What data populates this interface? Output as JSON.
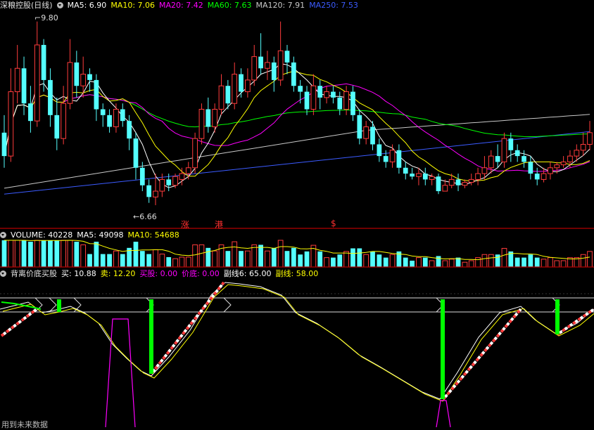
{
  "header_main": {
    "title": "深粮控股(日线)",
    "ma": [
      {
        "label": "MA5: 6.90",
        "color": "#ffffff"
      },
      {
        "label": "MA10: 7.06",
        "color": "#ffff00"
      },
      {
        "label": "MA20: 7.42",
        "color": "#ff00ff"
      },
      {
        "label": "MA60: 7.63",
        "color": "#00ff00"
      },
      {
        "label": "MA120: 7.91",
        "color": "#c8c8c8"
      },
      {
        "label": "MA250: 7.53",
        "color": "#3b5bff"
      }
    ]
  },
  "price_labels": {
    "high": "9.80",
    "low": "6.66"
  },
  "markers": [
    {
      "text": "涨",
      "color": "#ff3030"
    },
    {
      "text": "港",
      "color": "#ff3030"
    },
    {
      "text": "$",
      "color": "#ff3030"
    }
  ],
  "header_volume": {
    "items": [
      {
        "label": "VOLUME: 40228",
        "color": "#ffffff"
      },
      {
        "label": "MA5: 49098",
        "color": "#ffffff"
      },
      {
        "label": "MA10: 54688",
        "color": "#ffff00"
      }
    ]
  },
  "header_indicator": {
    "title": "背离价底买股",
    "items": [
      {
        "label": "买: 10.88",
        "color": "#ffffff"
      },
      {
        "label": "卖: 12.20",
        "color": "#ffff00"
      },
      {
        "label": "买股: 0.00",
        "color": "#ff00ff"
      },
      {
        "label": "价底: 0.00",
        "color": "#ff00ff"
      },
      {
        "label": "副线6: 65.00",
        "color": "#ffffff"
      },
      {
        "label": "副线: 58.00",
        "color": "#ffff00"
      }
    ]
  },
  "footer_note": "用到未来数据",
  "colors": {
    "up": "#ff3c3c",
    "down": "#54ffff",
    "border": "#b40000",
    "ma5": "#ffffff",
    "ma10": "#ffff00",
    "ma20": "#ff00ff",
    "ma60": "#00ff00",
    "ma120": "#c8c8c8",
    "ma250": "#3b5bff",
    "signal": "#00ff00",
    "spike": "#ff00ff"
  },
  "chart_data": {
    "type": "candlestick",
    "price_range": [
      6.3,
      10.0
    ],
    "candles": [
      {
        "o": 7.9,
        "c": 7.5,
        "h": 8.2,
        "l": 7.3
      },
      {
        "o": 7.5,
        "c": 8.6,
        "h": 9.0,
        "l": 7.4
      },
      {
        "o": 8.6,
        "c": 9.0,
        "h": 9.4,
        "l": 8.4
      },
      {
        "o": 9.0,
        "c": 8.4,
        "h": 9.2,
        "l": 8.2
      },
      {
        "o": 8.4,
        "c": 8.1,
        "h": 8.7,
        "l": 7.9
      },
      {
        "o": 8.1,
        "c": 9.4,
        "h": 9.8,
        "l": 8.0
      },
      {
        "o": 9.4,
        "c": 8.8,
        "h": 9.5,
        "l": 8.6
      },
      {
        "o": 8.8,
        "c": 8.2,
        "h": 9.0,
        "l": 8.0
      },
      {
        "o": 8.2,
        "c": 7.8,
        "h": 8.5,
        "l": 7.6
      },
      {
        "o": 7.8,
        "c": 8.4,
        "h": 8.7,
        "l": 7.7
      },
      {
        "o": 8.4,
        "c": 9.1,
        "h": 9.5,
        "l": 8.3
      },
      {
        "o": 9.1,
        "c": 8.7,
        "h": 9.3,
        "l": 8.5
      },
      {
        "o": 8.7,
        "c": 8.9,
        "h": 9.2,
        "l": 8.5
      },
      {
        "o": 8.9,
        "c": 8.8,
        "h": 9.0,
        "l": 8.6
      },
      {
        "o": 8.8,
        "c": 8.3,
        "h": 8.9,
        "l": 8.1
      },
      {
        "o": 8.3,
        "c": 8.2,
        "h": 8.4,
        "l": 8.0
      },
      {
        "o": 8.2,
        "c": 8.0,
        "h": 8.3,
        "l": 7.9
      },
      {
        "o": 8.0,
        "c": 8.3,
        "h": 8.4,
        "l": 7.9
      },
      {
        "o": 8.3,
        "c": 8.1,
        "h": 8.4,
        "l": 8.0
      },
      {
        "o": 8.1,
        "c": 7.8,
        "h": 8.2,
        "l": 7.6
      },
      {
        "o": 7.8,
        "c": 7.3,
        "h": 7.9,
        "l": 7.1
      },
      {
        "o": 7.3,
        "c": 7.0,
        "h": 7.4,
        "l": 6.9
      },
      {
        "o": 7.0,
        "c": 6.8,
        "h": 7.1,
        "l": 6.7
      },
      {
        "o": 6.8,
        "c": 6.9,
        "h": 7.2,
        "l": 6.66
      },
      {
        "o": 6.9,
        "c": 7.1,
        "h": 7.2,
        "l": 6.8
      },
      {
        "o": 7.1,
        "c": 7.0,
        "h": 7.2,
        "l": 6.9
      },
      {
        "o": 7.0,
        "c": 7.15,
        "h": 7.2,
        "l": 6.95
      },
      {
        "o": 7.1,
        "c": 7.2,
        "h": 7.3,
        "l": 7.0
      },
      {
        "o": 7.2,
        "c": 7.3,
        "h": 7.4,
        "l": 7.1
      },
      {
        "o": 7.3,
        "c": 7.8,
        "h": 7.9,
        "l": 7.2
      },
      {
        "o": 7.8,
        "c": 8.3,
        "h": 8.4,
        "l": 7.7
      },
      {
        "o": 8.3,
        "c": 8.0,
        "h": 8.5,
        "l": 7.9
      },
      {
        "o": 8.0,
        "c": 8.3,
        "h": 8.4,
        "l": 7.9
      },
      {
        "o": 8.3,
        "c": 8.7,
        "h": 8.9,
        "l": 8.2
      },
      {
        "o": 8.7,
        "c": 8.4,
        "h": 8.8,
        "l": 8.3
      },
      {
        "o": 8.4,
        "c": 8.9,
        "h": 9.1,
        "l": 8.3
      },
      {
        "o": 8.9,
        "c": 8.6,
        "h": 9.0,
        "l": 8.5
      },
      {
        "o": 8.6,
        "c": 8.8,
        "h": 9.0,
        "l": 8.5
      },
      {
        "o": 8.8,
        "c": 9.2,
        "h": 9.4,
        "l": 8.7
      },
      {
        "o": 9.2,
        "c": 9.0,
        "h": 9.6,
        "l": 8.9
      },
      {
        "o": 9.0,
        "c": 9.1,
        "h": 9.3,
        "l": 8.8
      },
      {
        "o": 9.1,
        "c": 8.8,
        "h": 9.2,
        "l": 8.6
      },
      {
        "o": 8.8,
        "c": 9.3,
        "h": 9.8,
        "l": 8.7
      },
      {
        "o": 9.3,
        "c": 9.1,
        "h": 9.4,
        "l": 8.9
      },
      {
        "o": 9.1,
        "c": 8.7,
        "h": 9.2,
        "l": 8.6
      },
      {
        "o": 8.7,
        "c": 8.6,
        "h": 8.8,
        "l": 8.4
      },
      {
        "o": 8.6,
        "c": 8.3,
        "h": 8.7,
        "l": 8.2
      },
      {
        "o": 8.3,
        "c": 8.7,
        "h": 8.9,
        "l": 8.2
      },
      {
        "o": 8.7,
        "c": 8.5,
        "h": 8.8,
        "l": 8.3
      },
      {
        "o": 8.5,
        "c": 8.6,
        "h": 8.7,
        "l": 8.4
      },
      {
        "o": 8.6,
        "c": 8.5,
        "h": 8.7,
        "l": 8.4
      },
      {
        "o": 8.5,
        "c": 8.3,
        "h": 8.6,
        "l": 8.2
      },
      {
        "o": 8.3,
        "c": 8.6,
        "h": 8.7,
        "l": 8.2
      },
      {
        "o": 8.6,
        "c": 8.2,
        "h": 8.7,
        "l": 8.1
      },
      {
        "o": 8.2,
        "c": 7.8,
        "h": 8.3,
        "l": 7.7
      },
      {
        "o": 7.8,
        "c": 8.0,
        "h": 8.1,
        "l": 7.7
      },
      {
        "o": 8.0,
        "c": 7.7,
        "h": 8.1,
        "l": 7.6
      },
      {
        "o": 7.7,
        "c": 7.5,
        "h": 7.8,
        "l": 7.4
      },
      {
        "o": 7.5,
        "c": 7.4,
        "h": 7.6,
        "l": 7.3
      },
      {
        "o": 7.4,
        "c": 7.6,
        "h": 7.7,
        "l": 7.3
      },
      {
        "o": 7.6,
        "c": 7.3,
        "h": 7.7,
        "l": 7.2
      },
      {
        "o": 7.3,
        "c": 7.2,
        "h": 7.4,
        "l": 7.1
      },
      {
        "o": 7.2,
        "c": 7.15,
        "h": 7.3,
        "l": 7.1
      },
      {
        "o": 7.15,
        "c": 7.2,
        "h": 7.3,
        "l": 7.0
      },
      {
        "o": 7.2,
        "c": 7.1,
        "h": 7.3,
        "l": 7.0
      },
      {
        "o": 7.1,
        "c": 7.15,
        "h": 7.2,
        "l": 7.0
      },
      {
        "o": 7.15,
        "c": 6.9,
        "h": 7.2,
        "l": 6.85
      },
      {
        "o": 6.9,
        "c": 7.0,
        "h": 7.1,
        "l": 6.9
      },
      {
        "o": 7.0,
        "c": 7.1,
        "h": 7.2,
        "l": 6.95
      },
      {
        "o": 7.1,
        "c": 7.0,
        "h": 7.2,
        "l": 6.9
      },
      {
        "o": 7.0,
        "c": 7.05,
        "h": 7.1,
        "l": 6.95
      },
      {
        "o": 7.05,
        "c": 7.1,
        "h": 7.2,
        "l": 7.0
      },
      {
        "o": 7.1,
        "c": 7.2,
        "h": 7.3,
        "l": 7.0
      },
      {
        "o": 7.2,
        "c": 7.3,
        "h": 7.5,
        "l": 7.1
      },
      {
        "o": 7.3,
        "c": 7.5,
        "h": 7.6,
        "l": 7.2
      },
      {
        "o": 7.5,
        "c": 7.4,
        "h": 7.7,
        "l": 7.3
      },
      {
        "o": 7.4,
        "c": 7.8,
        "h": 7.9,
        "l": 7.3
      },
      {
        "o": 7.8,
        "c": 7.6,
        "h": 7.9,
        "l": 7.4
      },
      {
        "o": 7.6,
        "c": 7.5,
        "h": 7.7,
        "l": 7.4
      },
      {
        "o": 7.5,
        "c": 7.4,
        "h": 7.6,
        "l": 7.3
      },
      {
        "o": 7.4,
        "c": 7.2,
        "h": 7.5,
        "l": 7.1
      },
      {
        "o": 7.2,
        "c": 7.1,
        "h": 7.3,
        "l": 7.0
      },
      {
        "o": 7.1,
        "c": 7.2,
        "h": 7.3,
        "l": 7.05
      },
      {
        "o": 7.2,
        "c": 7.3,
        "h": 7.4,
        "l": 7.1
      },
      {
        "o": 7.3,
        "c": 7.35,
        "h": 7.4,
        "l": 7.2
      },
      {
        "o": 7.35,
        "c": 7.4,
        "h": 7.5,
        "l": 7.3
      },
      {
        "o": 7.4,
        "c": 7.5,
        "h": 7.6,
        "l": 7.3
      },
      {
        "o": 7.5,
        "c": 7.6,
        "h": 7.7,
        "l": 7.4
      },
      {
        "o": 7.6,
        "c": 7.7,
        "h": 7.9,
        "l": 7.5
      },
      {
        "o": 7.7,
        "c": 7.9,
        "h": 8.1,
        "l": 7.6
      }
    ]
  }
}
